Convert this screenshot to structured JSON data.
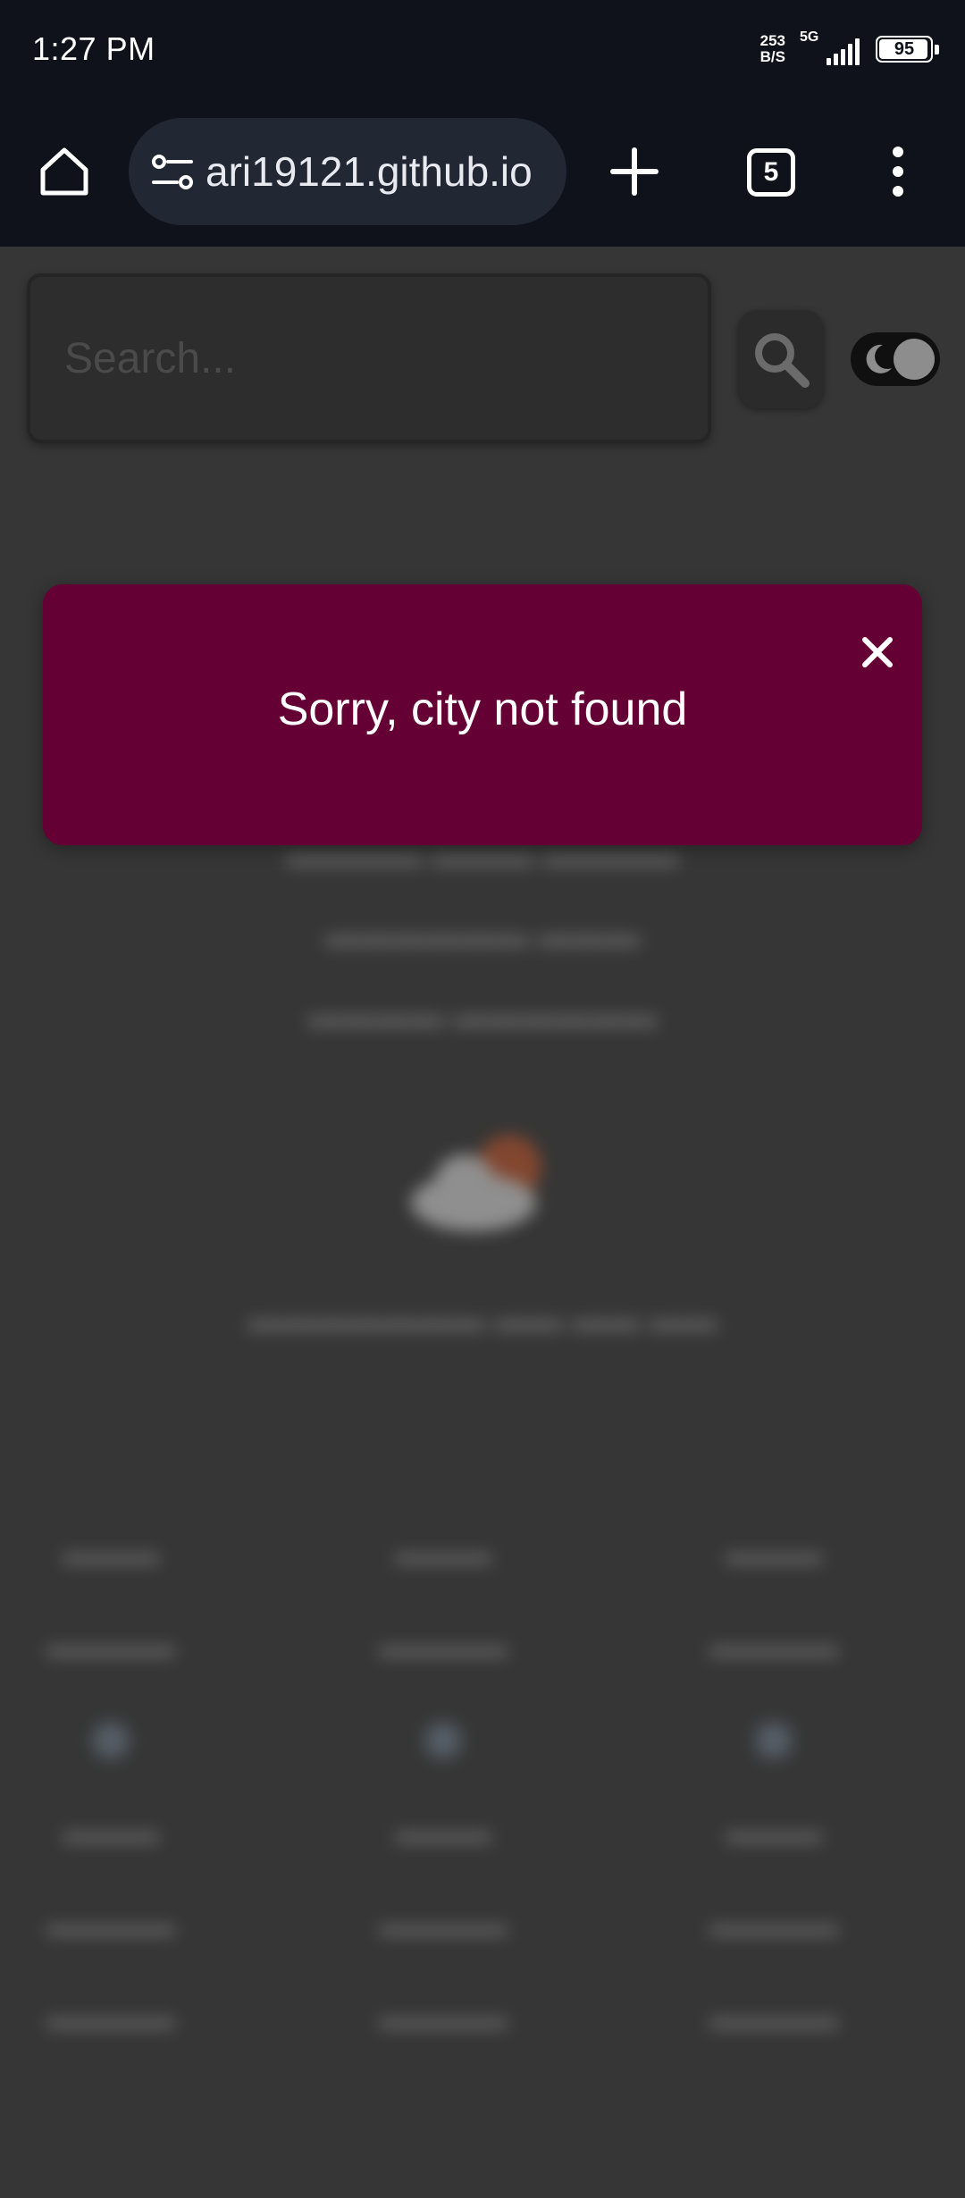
{
  "status_bar": {
    "time": "1:27 PM",
    "net_speed_value": "253",
    "net_speed_unit": "B/S",
    "network": "5G",
    "battery": "95"
  },
  "browser": {
    "url": "ari19121.github.io",
    "tab_count": "5",
    "icons": [
      "home-icon",
      "site-settings-icon",
      "plus-icon",
      "tabs-icon",
      "more-vert-icon"
    ]
  },
  "search": {
    "placeholder": "Search..."
  },
  "alert": {
    "message": "Sorry, city not found",
    "close_label": "×"
  },
  "colors": {
    "alert_bg": "#650035",
    "page_bg": "#363636",
    "toolbar_bg": "#0f121a"
  }
}
